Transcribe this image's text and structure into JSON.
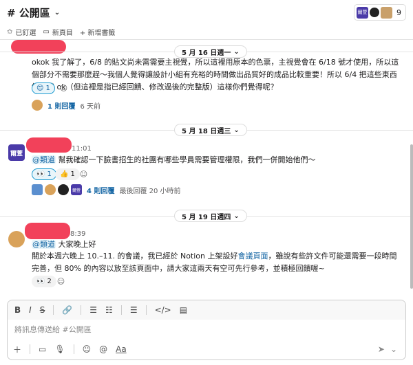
{
  "header": {
    "channel_name": "# 公開區",
    "member_count": "9",
    "member_label": "爾萱"
  },
  "bookmarks": {
    "items": [
      "已釘選",
      "新頁目",
      "+ 新增書籤"
    ]
  },
  "dates": [
    "5 月 16 日週一",
    "5 月 18 日週三",
    "5 月 19 日週四"
  ],
  "messages": [
    {
      "text": "okok 我了解了，6/8 的貼文尚未需需要主視覺，所以這裡用原本的色票，主視覺會在 6/18 號才使用，所以這個部分不需要那麼趕～我個人覺得讓設計小組有充裕的時間做出品質好的成品比較重要！所以 6/4 把這些東西給我就 ok（但這裡是指已經回饋、修改過後的完整版）這樣你們覺得呢？",
      "reaction_count": "1",
      "thread_count": "1 則回覆",
      "thread_meta": "6 天前"
    },
    {
      "avatar_label": "爾萱",
      "time": "11:01",
      "mention": "@類道",
      "text": " 幫我確認一下臉書招生的社團有哪些學員需要管理權限，我們一併開始他們～",
      "reaction_1": "1",
      "reaction_2": "1",
      "thread_count": "4 則回覆",
      "thread_meta": "最後回覆 20 小時前"
    },
    {
      "time": "8:39",
      "mention": "@類道",
      "greeting": " 大家晚上好",
      "text_a": "關於本週六晚上 10.–11. 的會議，我已經於 Notion 上架設好",
      "link": "會議頁面",
      "text_b": "，雖說有些許文件可能還需要一段時間完善，但 80% 的內容以放至該頁面中，請大家這兩天有空可先行參考，並積極回饋喔~",
      "reaction_count": "2"
    }
  ],
  "composer": {
    "placeholder": "將訊息傳送給 #公開區"
  }
}
